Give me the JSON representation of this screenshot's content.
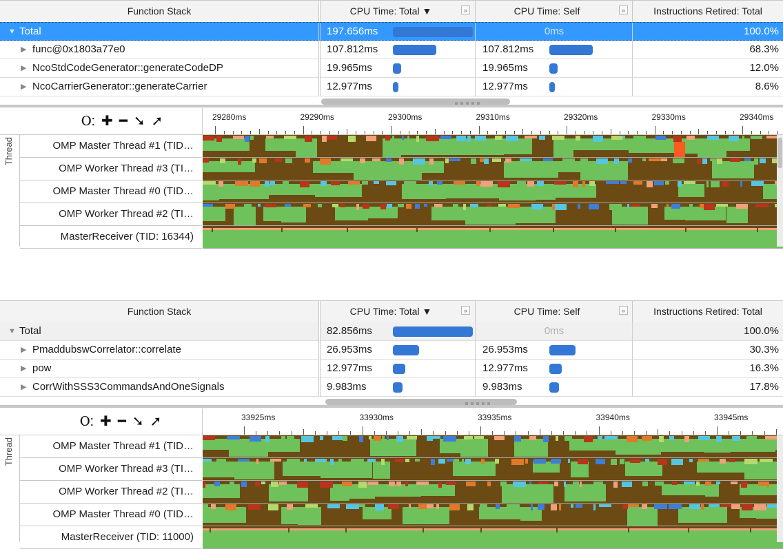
{
  "colors": {
    "selection": "#3399ff",
    "bar": "#3478d6",
    "lane_dark": "#6b4a14",
    "lane_green": "#6ec15b",
    "lane_lime": "#b6d96b",
    "lane_cyan": "#56c6e0",
    "lane_blue": "#3d7ed9",
    "lane_orange": "#e07a2a",
    "lane_salmon": "#f0a07a",
    "lane_red": "#b8341b",
    "lane_alert": "#ff5a1f"
  },
  "columns": {
    "function_stack": "Function Stack",
    "cpu_total": "CPU Time: Total ▼",
    "cpu_self": "CPU Time: Self",
    "instructions": "Instructions Retired: Total",
    "expand_glyph": "»"
  },
  "toolbar": {
    "zoom_icon": "magnifier-icon",
    "glyphs": [
      "Ⲟ:",
      "✚",
      "━",
      "➘",
      "➚"
    ]
  },
  "axis_label": "Thread",
  "panels": [
    {
      "rows": [
        {
          "name": "Total",
          "total": "197.656ms",
          "total_frac": 1.0,
          "self": "0ms",
          "self_frac": 0,
          "instr": "100.0%",
          "level": 0,
          "selected": true
        },
        {
          "name": "func@0x1803a77e0",
          "total": "107.812ms",
          "total_frac": 0.545,
          "self": "107.812ms",
          "self_frac": 0.545,
          "instr": "68.3%",
          "level": 1
        },
        {
          "name": "NcoStdCodeGenerator::generateCodeDP",
          "total": "19.965ms",
          "total_frac": 0.1,
          "self": "19.965ms",
          "self_frac": 0.1,
          "instr": "12.0%",
          "level": 1
        },
        {
          "name": "NcoCarrierGenerator::generateCarrier",
          "total": "12.977ms",
          "total_frac": 0.065,
          "self": "12.977ms",
          "self_frac": 0.065,
          "instr": "8.6%",
          "level": 1
        }
      ],
      "ruler": [
        "29280ms",
        "29290ms",
        "29300ms",
        "29310ms",
        "29320ms",
        "29330ms",
        "29340ms"
      ],
      "threads": [
        "OMP Master Thread #1 (TID…",
        "OMP Worker Thread #3 (TI…",
        "OMP Master Thread #0 (TID…",
        "OMP Worker Thread #2 (TI…",
        "MasterReceiver (TID: 16344)"
      ]
    },
    {
      "rows": [
        {
          "name": "Total",
          "total": "82.856ms",
          "total_frac": 1.0,
          "self": "0ms",
          "self_frac": 0,
          "instr": "100.0%",
          "level": 0,
          "selected": false
        },
        {
          "name": "PmaddubswCorrelator::correlate",
          "total": "26.953ms",
          "total_frac": 0.325,
          "self": "26.953ms",
          "self_frac": 0.325,
          "instr": "30.3%",
          "level": 1
        },
        {
          "name": "pow",
          "total": "12.977ms",
          "total_frac": 0.157,
          "self": "12.977ms",
          "self_frac": 0.157,
          "instr": "16.3%",
          "level": 1
        },
        {
          "name": "CorrWithSSS3CommandsAndOneSignals",
          "total": "9.983ms",
          "total_frac": 0.12,
          "self": "9.983ms",
          "self_frac": 0.12,
          "instr": "17.8%",
          "level": 1
        }
      ],
      "ruler": [
        "33925ms",
        "33930ms",
        "33935ms",
        "33940ms",
        "33945ms"
      ],
      "threads": [
        "OMP Master Thread #1 (TID…",
        "OMP Worker Thread #3 (TI…",
        "OMP Worker Thread #2 (TI…",
        "OMP Master Thread #0 (TID…",
        "MasterReceiver (TID: 11000)"
      ]
    }
  ]
}
